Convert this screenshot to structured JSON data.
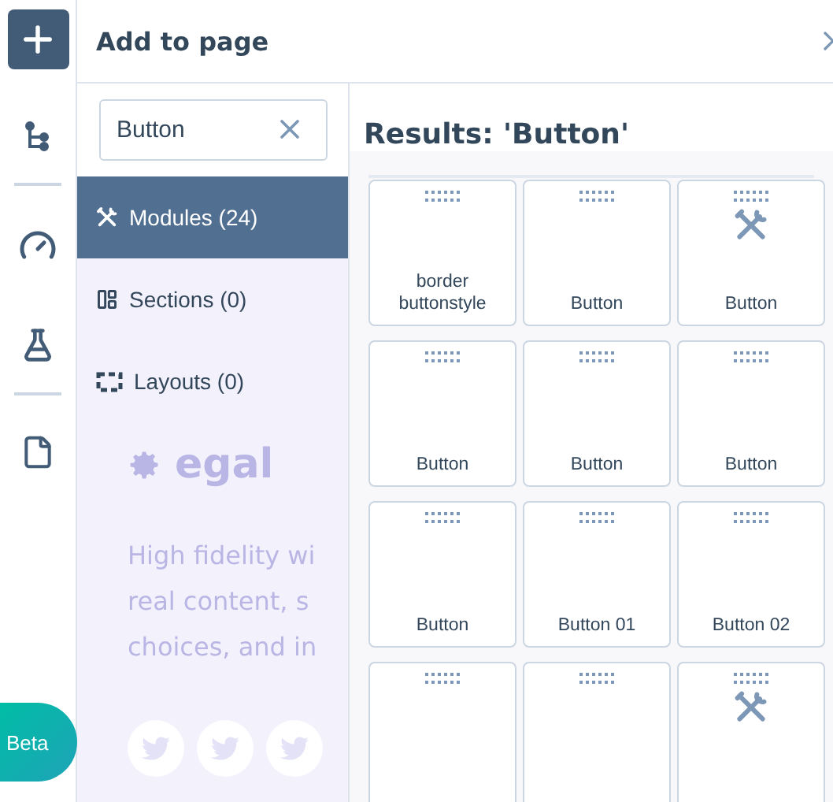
{
  "rail": {
    "beta": "Beta"
  },
  "panel": {
    "title": "Add to page",
    "search": {
      "value": "Button"
    },
    "categories": [
      {
        "kind": "modules",
        "label": "Modules (24)",
        "selected": true
      },
      {
        "kind": "sections",
        "label": "Sections (0)",
        "selected": false
      },
      {
        "kind": "layouts",
        "label": "Layouts (0)",
        "selected": false
      }
    ],
    "backdrop": {
      "logo": "egal",
      "lines": [
        "High fidelity wi",
        "real content, s",
        "choices, and in"
      ]
    },
    "results_title": "Results: 'Button'",
    "results": [
      {
        "label": "border buttonstyle",
        "kind": "plain"
      },
      {
        "label": "Button",
        "kind": "plain"
      },
      {
        "label": "Button",
        "kind": "tool"
      },
      {
        "label": "Button",
        "kind": "plain"
      },
      {
        "label": "Button",
        "kind": "plain"
      },
      {
        "label": "Button",
        "kind": "plain"
      },
      {
        "label": "Button",
        "kind": "plain"
      },
      {
        "label": "Button 01",
        "kind": "plain"
      },
      {
        "label": "Button 02",
        "kind": "plain"
      },
      {
        "kind": "plain"
      },
      {
        "kind": "plain"
      },
      {
        "kind": "tool"
      }
    ]
  }
}
